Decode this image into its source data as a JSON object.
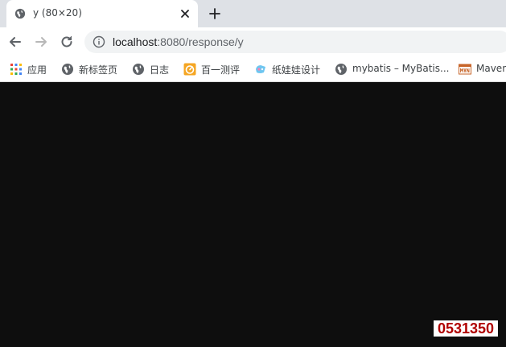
{
  "tab": {
    "title": "y (80×20)"
  },
  "address_bar": {
    "host": "localhost",
    "path": ":8080/response/y"
  },
  "bookmarks": [
    {
      "label": "应用",
      "icon": "apps-grid-icon"
    },
    {
      "label": "新标签页",
      "icon": "globe-icon"
    },
    {
      "label": "日志",
      "icon": "globe-icon"
    },
    {
      "label": "百一测评",
      "icon": "baiyi-logo-icon"
    },
    {
      "label": "纸娃娃设计",
      "icon": "paperdoll-logo-icon"
    },
    {
      "label": "mybatis – MyBatis...",
      "icon": "globe-icon"
    },
    {
      "label": "Maven",
      "icon": "mvn-logo-icon"
    }
  ],
  "captcha": {
    "text": "0531350"
  },
  "colors": {
    "captcha_text": "#b00000",
    "page_background": "#0e0e0e",
    "tab_strip": "#dee1e6"
  }
}
